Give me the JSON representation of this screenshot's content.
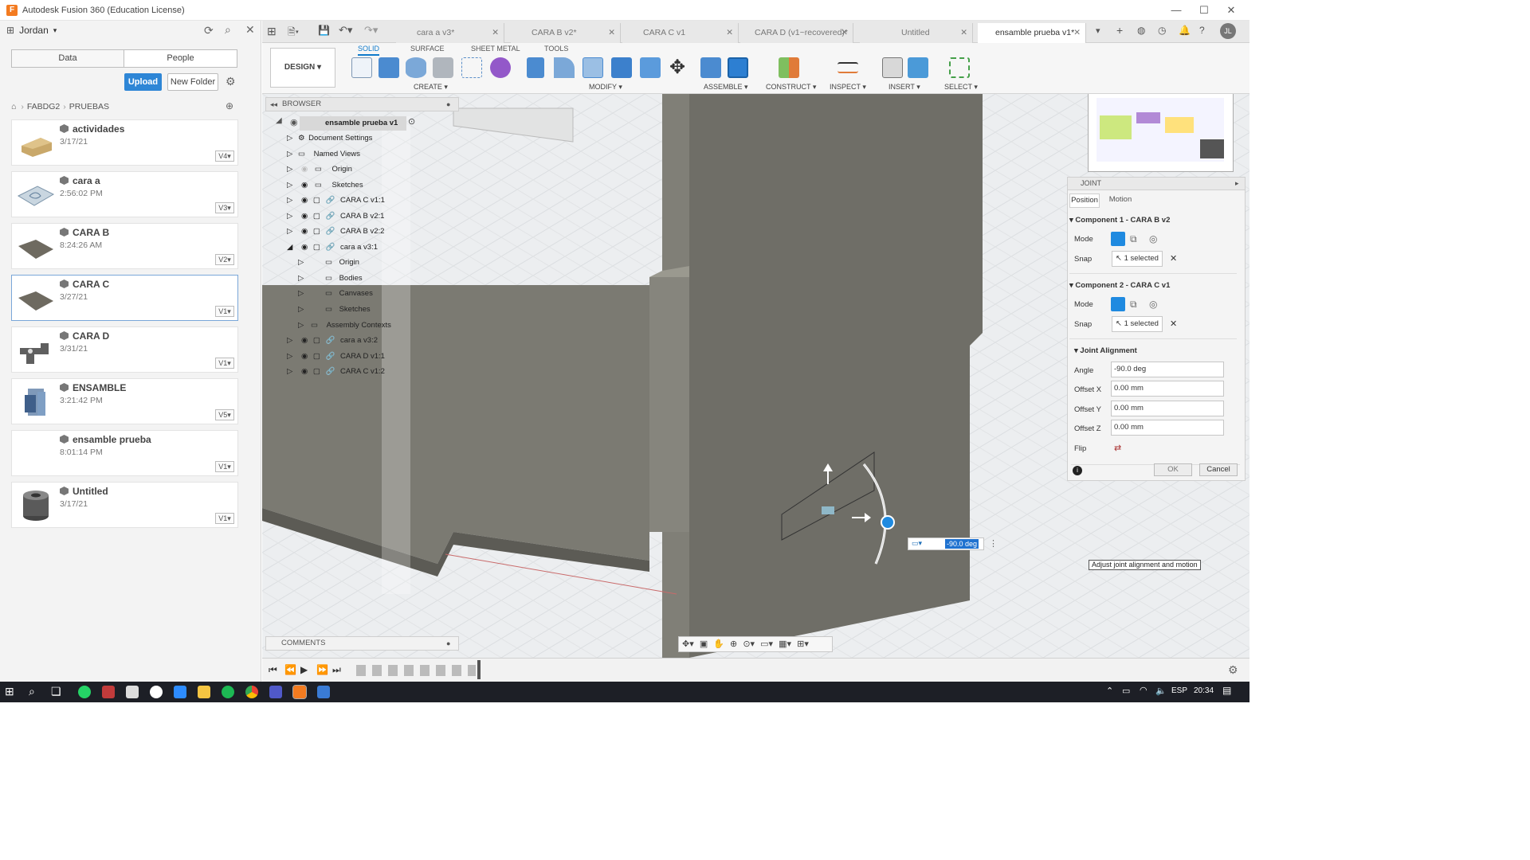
{
  "window": {
    "title": "Autodesk Fusion 360 (Education License)",
    "logo": "F"
  },
  "left": {
    "user": "Jordan",
    "tabs": [
      "Data",
      "People"
    ],
    "upload": "Upload",
    "new_folder": "New Folder",
    "breadcrumb": [
      "FABDG2",
      "PRUEBAS"
    ],
    "items": [
      {
        "name": "actividades",
        "date": "3/17/21",
        "version": "V4",
        "thumb": "#c9a86a"
      },
      {
        "name": "cara a",
        "date": "2:56:02 PM",
        "version": "V3",
        "thumb": "#9bb3c7"
      },
      {
        "name": "CARA B",
        "date": "8:24:26 AM",
        "version": "V2",
        "thumb": "#6e6a60"
      },
      {
        "name": "CARA C",
        "date": "3/27/21",
        "version": "V1",
        "thumb": "#6e6a60"
      },
      {
        "name": "CARA D",
        "date": "3/31/21",
        "version": "V1",
        "thumb": "#5f5f5f"
      },
      {
        "name": "ENSAMBLE",
        "date": "3:21:42 PM",
        "version": "V5",
        "thumb": "#5f7fa8"
      },
      {
        "name": "ensamble prueba",
        "date": "8:01:14 PM",
        "version": "V1",
        "thumb": "#ffffff"
      },
      {
        "name": "Untitled",
        "date": "3/17/21",
        "version": "V1",
        "thumb": "#555555"
      }
    ]
  },
  "doctabs": [
    "cara a v3*",
    "CARA B v2*",
    "CARA C v1",
    "CARA D (v1~recovered)*",
    "Untitled",
    "ensamble prueba v1*"
  ],
  "toolbar": {
    "workspace": "DESIGN",
    "tabs": [
      "SOLID",
      "SURFACE",
      "SHEET METAL",
      "TOOLS"
    ],
    "groups": [
      "CREATE",
      "MODIFY",
      "ASSEMBLE",
      "CONSTRUCT",
      "INSPECT",
      "INSERT",
      "SELECT"
    ]
  },
  "browser": {
    "title": "BROWSER",
    "root": "ensamble prueba v1",
    "nodes": [
      "Document Settings",
      "Named Views",
      "Origin",
      "Sketches",
      "CARA C v1:1",
      "CARA B v2:1",
      "CARA B v2:2",
      "cara a v3:1",
      "Origin",
      "Bodies",
      "Canvases",
      "Sketches",
      "Assembly Contexts",
      "cara a v3:2",
      "CARA D v1:1",
      "CARA C v1:2"
    ]
  },
  "comments": "COMMENTS",
  "joint": {
    "title": "JOINT",
    "tabs": [
      "Position",
      "Motion"
    ],
    "comp1": "Component 1 - CARA B v2",
    "comp2": "Component 2 - CARA C v1",
    "mode": "Mode",
    "snap": "Snap",
    "selected": "1 selected",
    "align": "Joint Alignment",
    "fields": [
      {
        "label": "Angle",
        "value": "-90.0 deg"
      },
      {
        "label": "Offset X",
        "value": "0.00 mm"
      },
      {
        "label": "Offset Y",
        "value": "0.00 mm"
      },
      {
        "label": "Offset Z",
        "value": "0.00 mm"
      }
    ],
    "flip": "Flip",
    "ok": "OK",
    "cancel": "Cancel"
  },
  "viewport": {
    "angle_input": "-90.0 deg",
    "tooltip": "Adjust joint alignment and motion"
  },
  "taskbar": {
    "lang": "ESP",
    "time": "20:34"
  },
  "colors": {
    "accent": "#0f7acb",
    "body": "#6f6e67",
    "bg": "#e9ebed"
  }
}
